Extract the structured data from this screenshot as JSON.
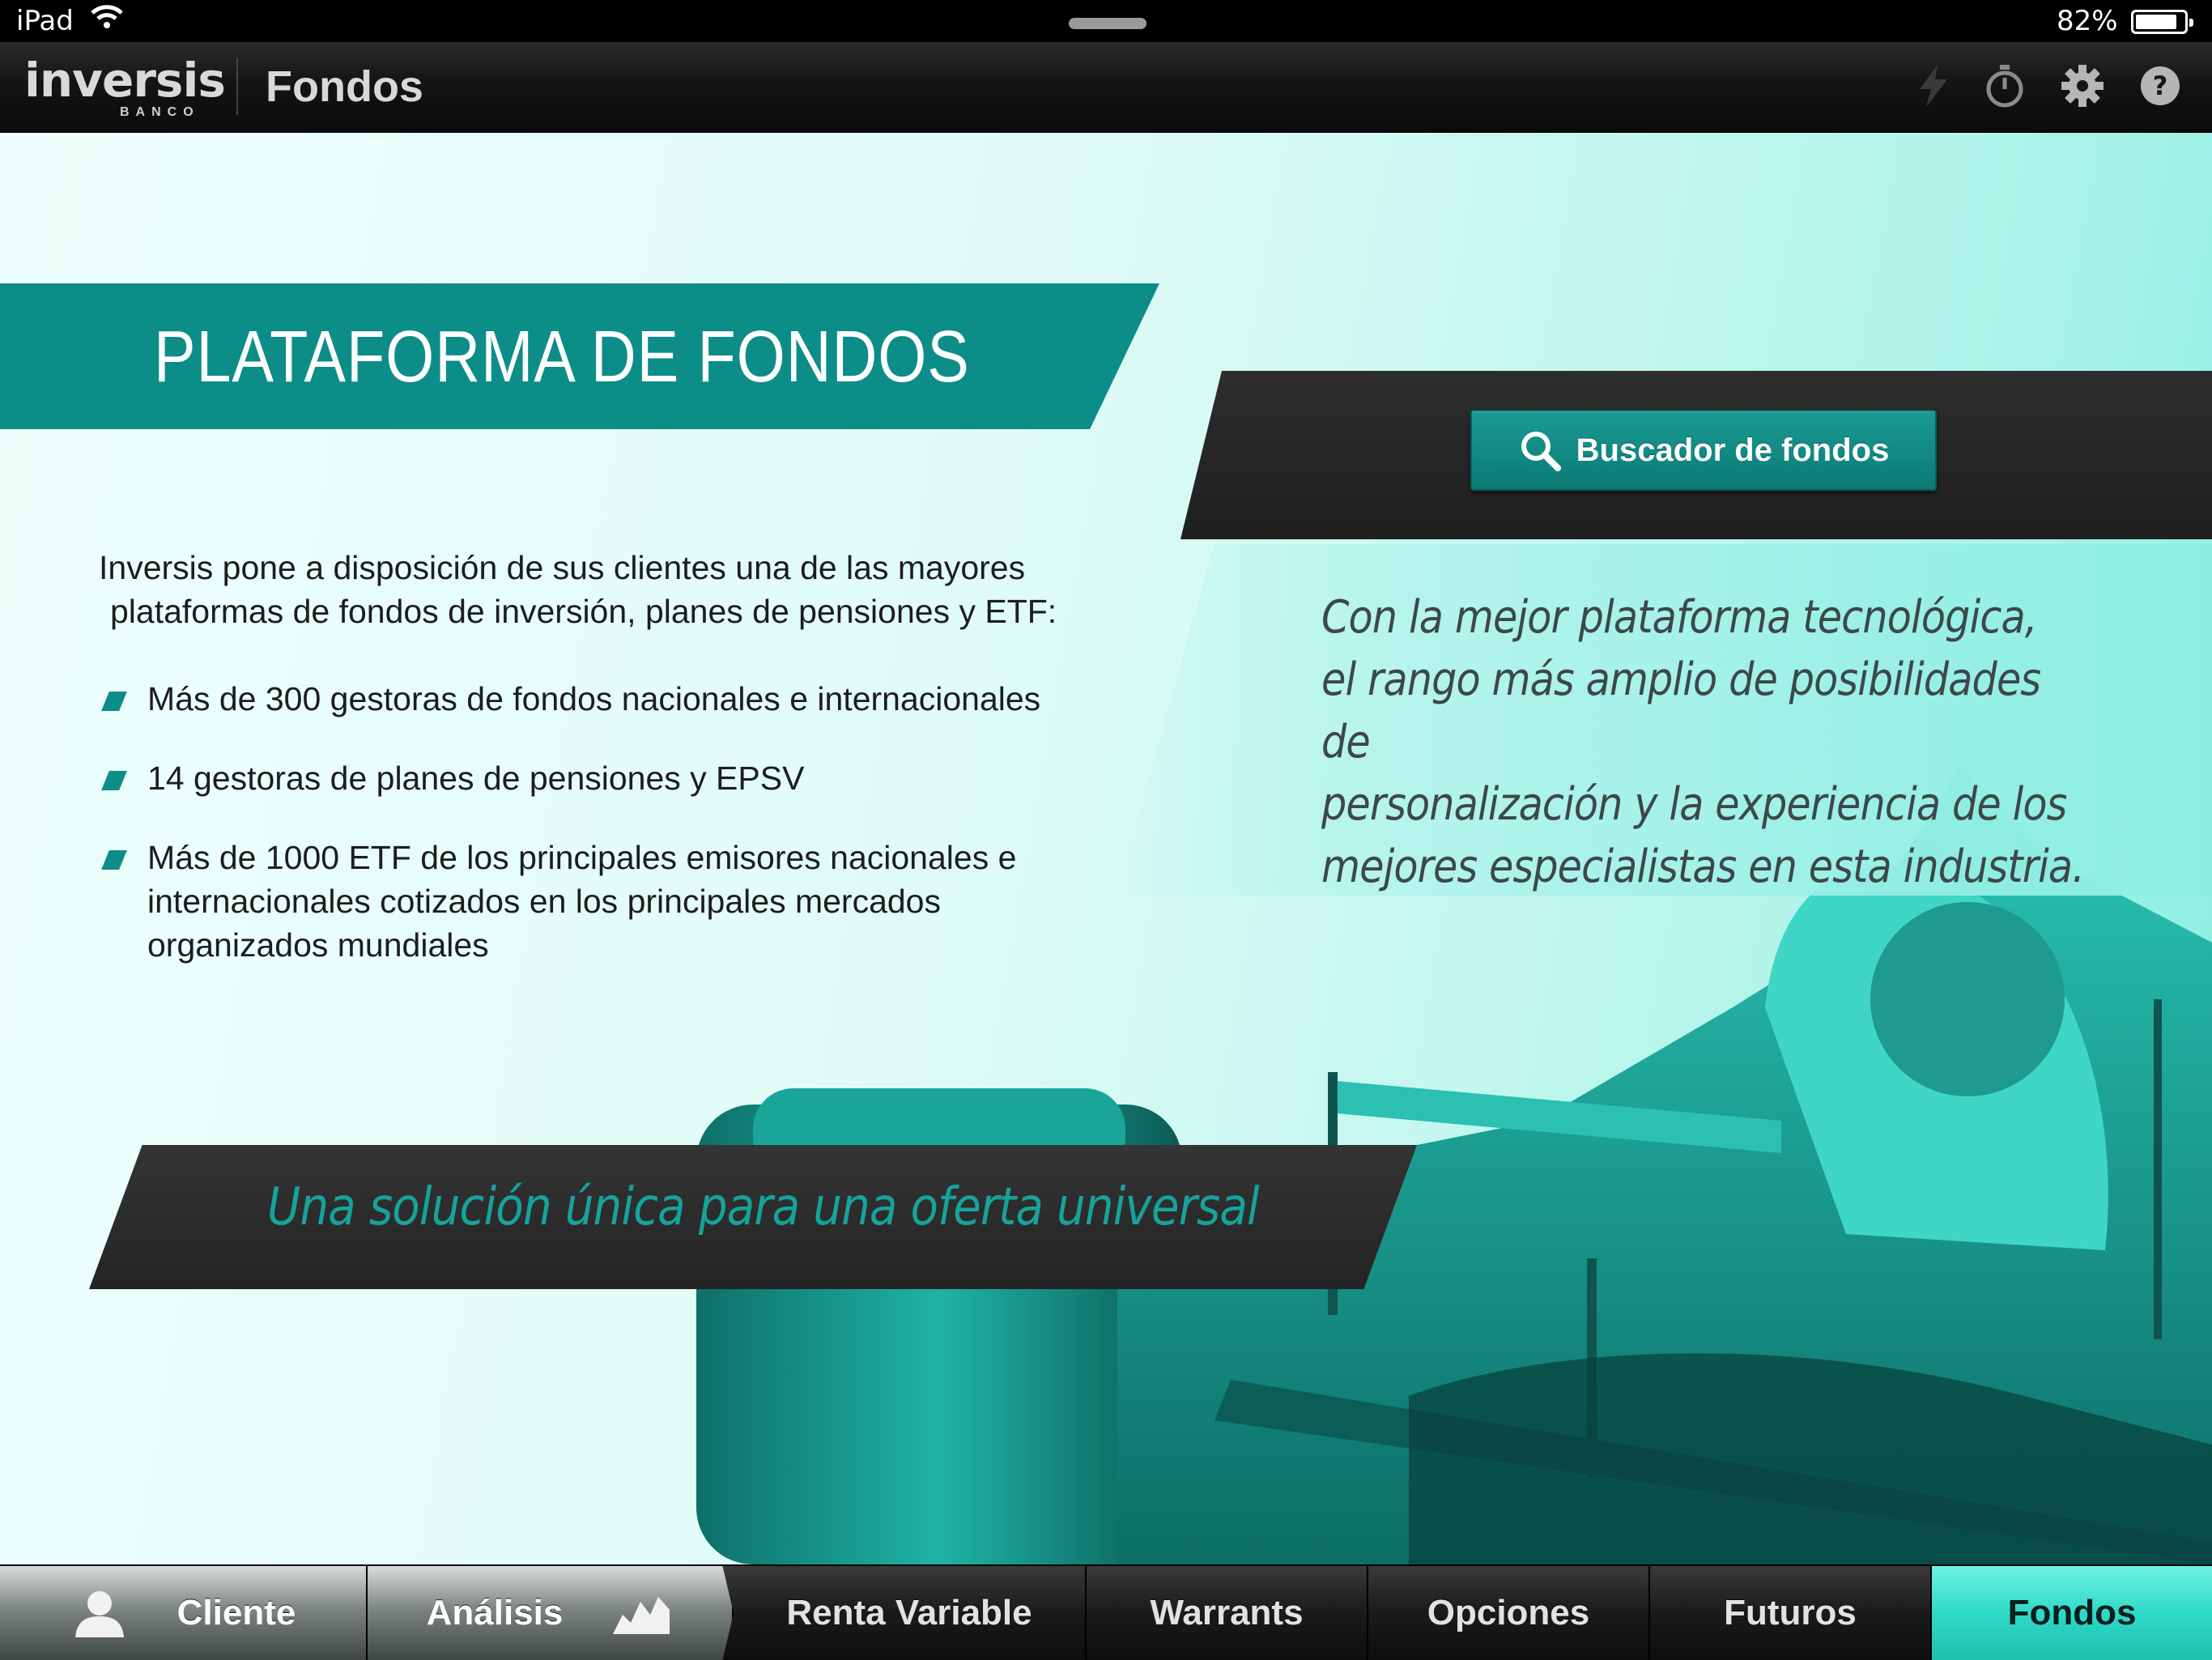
{
  "status_bar": {
    "device": "iPad",
    "battery": "82%"
  },
  "header": {
    "logo_word": "inversis",
    "logo_sub": "BANCO",
    "title": "Fondos"
  },
  "content": {
    "title": "PLATAFORMA DE FONDOS",
    "intro_line1": "Inversis pone a disposición de sus clientes una de las mayores",
    "intro_line2": "plataformas de fondos de inversión, planes de pensiones y ETF:",
    "bullets": [
      "Más de 300 gestoras de fondos nacionales e internacionales",
      "14 gestoras de planes de pensiones y EPSV",
      "Más de 1000 ETF de los principales emisores nacionales e internacionales cotizados en los principales mercados organizados mundiales"
    ],
    "search_button": "Buscador de fondos",
    "quote_lines": [
      "Con la mejor plataforma tecnológica,",
      "el rango más amplio de posibilidades de",
      "personalización y la experiencia de los",
      "mejores especialistas en esta industria."
    ],
    "slogan": "Una solución única para una oferta universal"
  },
  "tabs": [
    {
      "label": "Cliente",
      "icon": "user-icon"
    },
    {
      "label": "Análisis",
      "icon": "chart-icon"
    },
    {
      "label": "Renta Variable"
    },
    {
      "label": "Warrants"
    },
    {
      "label": "Opciones"
    },
    {
      "label": "Futuros"
    },
    {
      "label": "Fondos",
      "active": true
    }
  ],
  "colors": {
    "accent": "#0c8d88",
    "active_tab": "#2fd9c8",
    "dark_band": "#262626"
  }
}
